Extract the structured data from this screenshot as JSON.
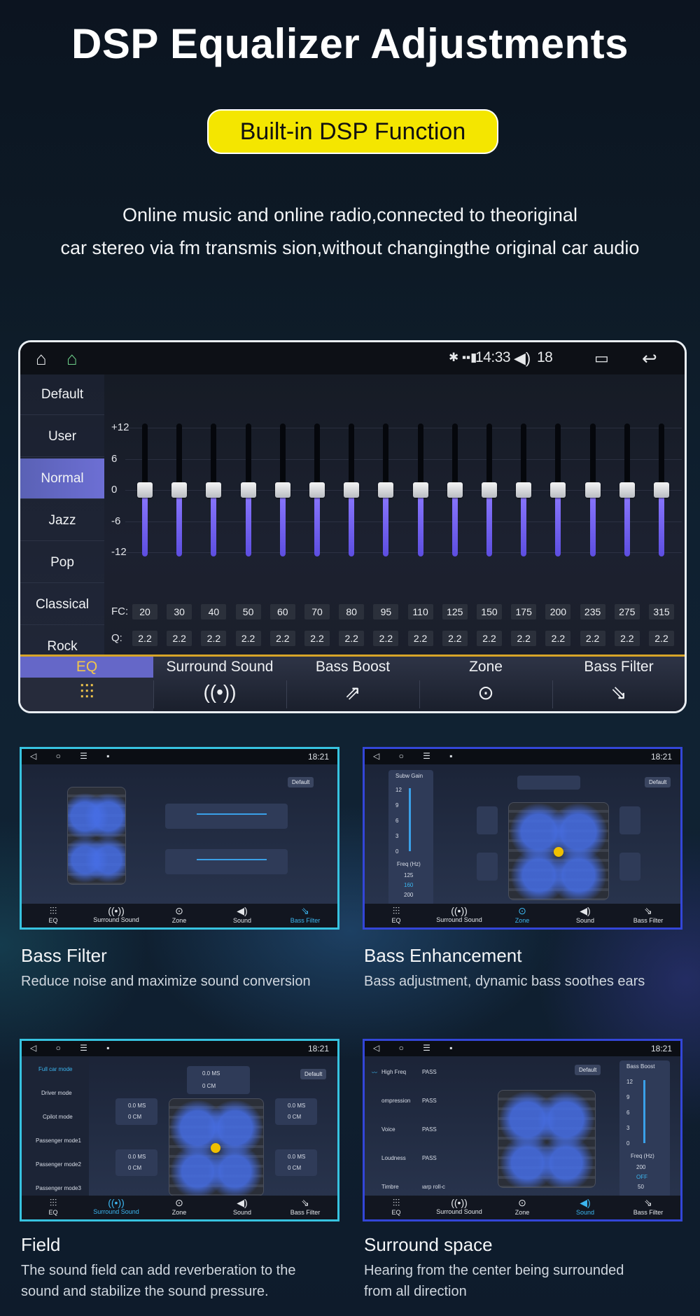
{
  "header": {
    "title": "DSP Equalizer Adjustments",
    "badge": "Built-in DSP Function",
    "desc_line1": "Online music and online radio,connected to theoriginal",
    "desc_line2": "car stereo via fm transmis sion,without changingthe original car audio"
  },
  "main_screen": {
    "status": {
      "time": "14:33",
      "volume": "18"
    },
    "presets": [
      "Default",
      "User",
      "Normal",
      "Jazz",
      "Pop",
      "Classical",
      "Rock"
    ],
    "active_preset": "Normal",
    "y_labels": [
      "+12",
      "6",
      "0",
      "-6",
      "-12"
    ],
    "fc_label": "FC:",
    "q_label": "Q:",
    "fc_values": [
      "20",
      "30",
      "40",
      "50",
      "60",
      "70",
      "80",
      "95",
      "110",
      "125",
      "150",
      "175",
      "200",
      "235",
      "275",
      "315"
    ],
    "q_values": [
      "2.2",
      "2.2",
      "2.2",
      "2.2",
      "2.2",
      "2.2",
      "2.2",
      "2.2",
      "2.2",
      "2.2",
      "2.2",
      "2.2",
      "2.2",
      "2.2",
      "2.2",
      "2.2"
    ],
    "band_gain": [
      0,
      0,
      0,
      0,
      0,
      0,
      0,
      0,
      0,
      0,
      0,
      0,
      0,
      0,
      0,
      0
    ],
    "tabs": [
      {
        "label": "EQ",
        "icon": "equalizer-icon"
      },
      {
        "label": "Surround Sound",
        "icon": "surround-icon"
      },
      {
        "label": "Bass Boost",
        "icon": "bass-boost-icon"
      },
      {
        "label": "Zone",
        "icon": "zone-icon"
      },
      {
        "label": "Bass Filter",
        "icon": "bass-filter-icon"
      }
    ],
    "active_tab": "EQ"
  },
  "mini_screens": {
    "status_time": "18:21",
    "nav": [
      "EQ",
      "Surround Sound",
      "Zone",
      "Sound",
      "Bass Filter"
    ],
    "default_label": "Default",
    "bass_filter": {
      "nav_active": "Bass Filter"
    },
    "bass_enh": {
      "nav_active": "Zone",
      "subw_gain": "Subw Gain",
      "scale": [
        "12",
        "9",
        "6",
        "3",
        "0"
      ],
      "freq_label": "Freq (Hz)",
      "freqs": [
        "125",
        "160",
        "200"
      ],
      "ch_value": "9"
    },
    "field": {
      "nav_active": "Surround Sound",
      "modes": [
        "Full car mode",
        "Driver mode",
        "Cpilot mode",
        "Passenger mode1",
        "Passenger mode2",
        "Passenger mode3"
      ],
      "ms": "0.0 MS",
      "cm": "0 CM"
    },
    "surround": {
      "nav_active": "Sound",
      "rows": [
        {
          "label": "High Freq",
          "value": "PASS"
        },
        {
          "label": "ompression",
          "value": "PASS"
        },
        {
          "label": "Voice",
          "value": "PASS"
        },
        {
          "label": "Loudness",
          "value": "PASS"
        },
        {
          "label": "Timbre",
          "value": "ιarp roll-c"
        }
      ],
      "bass_boost": "Bass Boost",
      "scale": [
        "12",
        "9",
        "6",
        "3",
        "0"
      ],
      "freq_label": "Freq (Hz)",
      "freqs": [
        "200",
        "OFF",
        "50"
      ]
    }
  },
  "captions": [
    {
      "title": "Bass Filter",
      "text": "Reduce noise and maximize sound conversion"
    },
    {
      "title": "Bass Enhancement",
      "text": "Bass adjustment, dynamic bass soothes ears"
    },
    {
      "title": "Field",
      "text1": "The sound field can add reverberation to the",
      "text2": "sound and stabilize the sound pressure."
    },
    {
      "title": "Surround space",
      "text1": "Hearing from the center being surrounded",
      "text2": "from all direction"
    }
  ]
}
